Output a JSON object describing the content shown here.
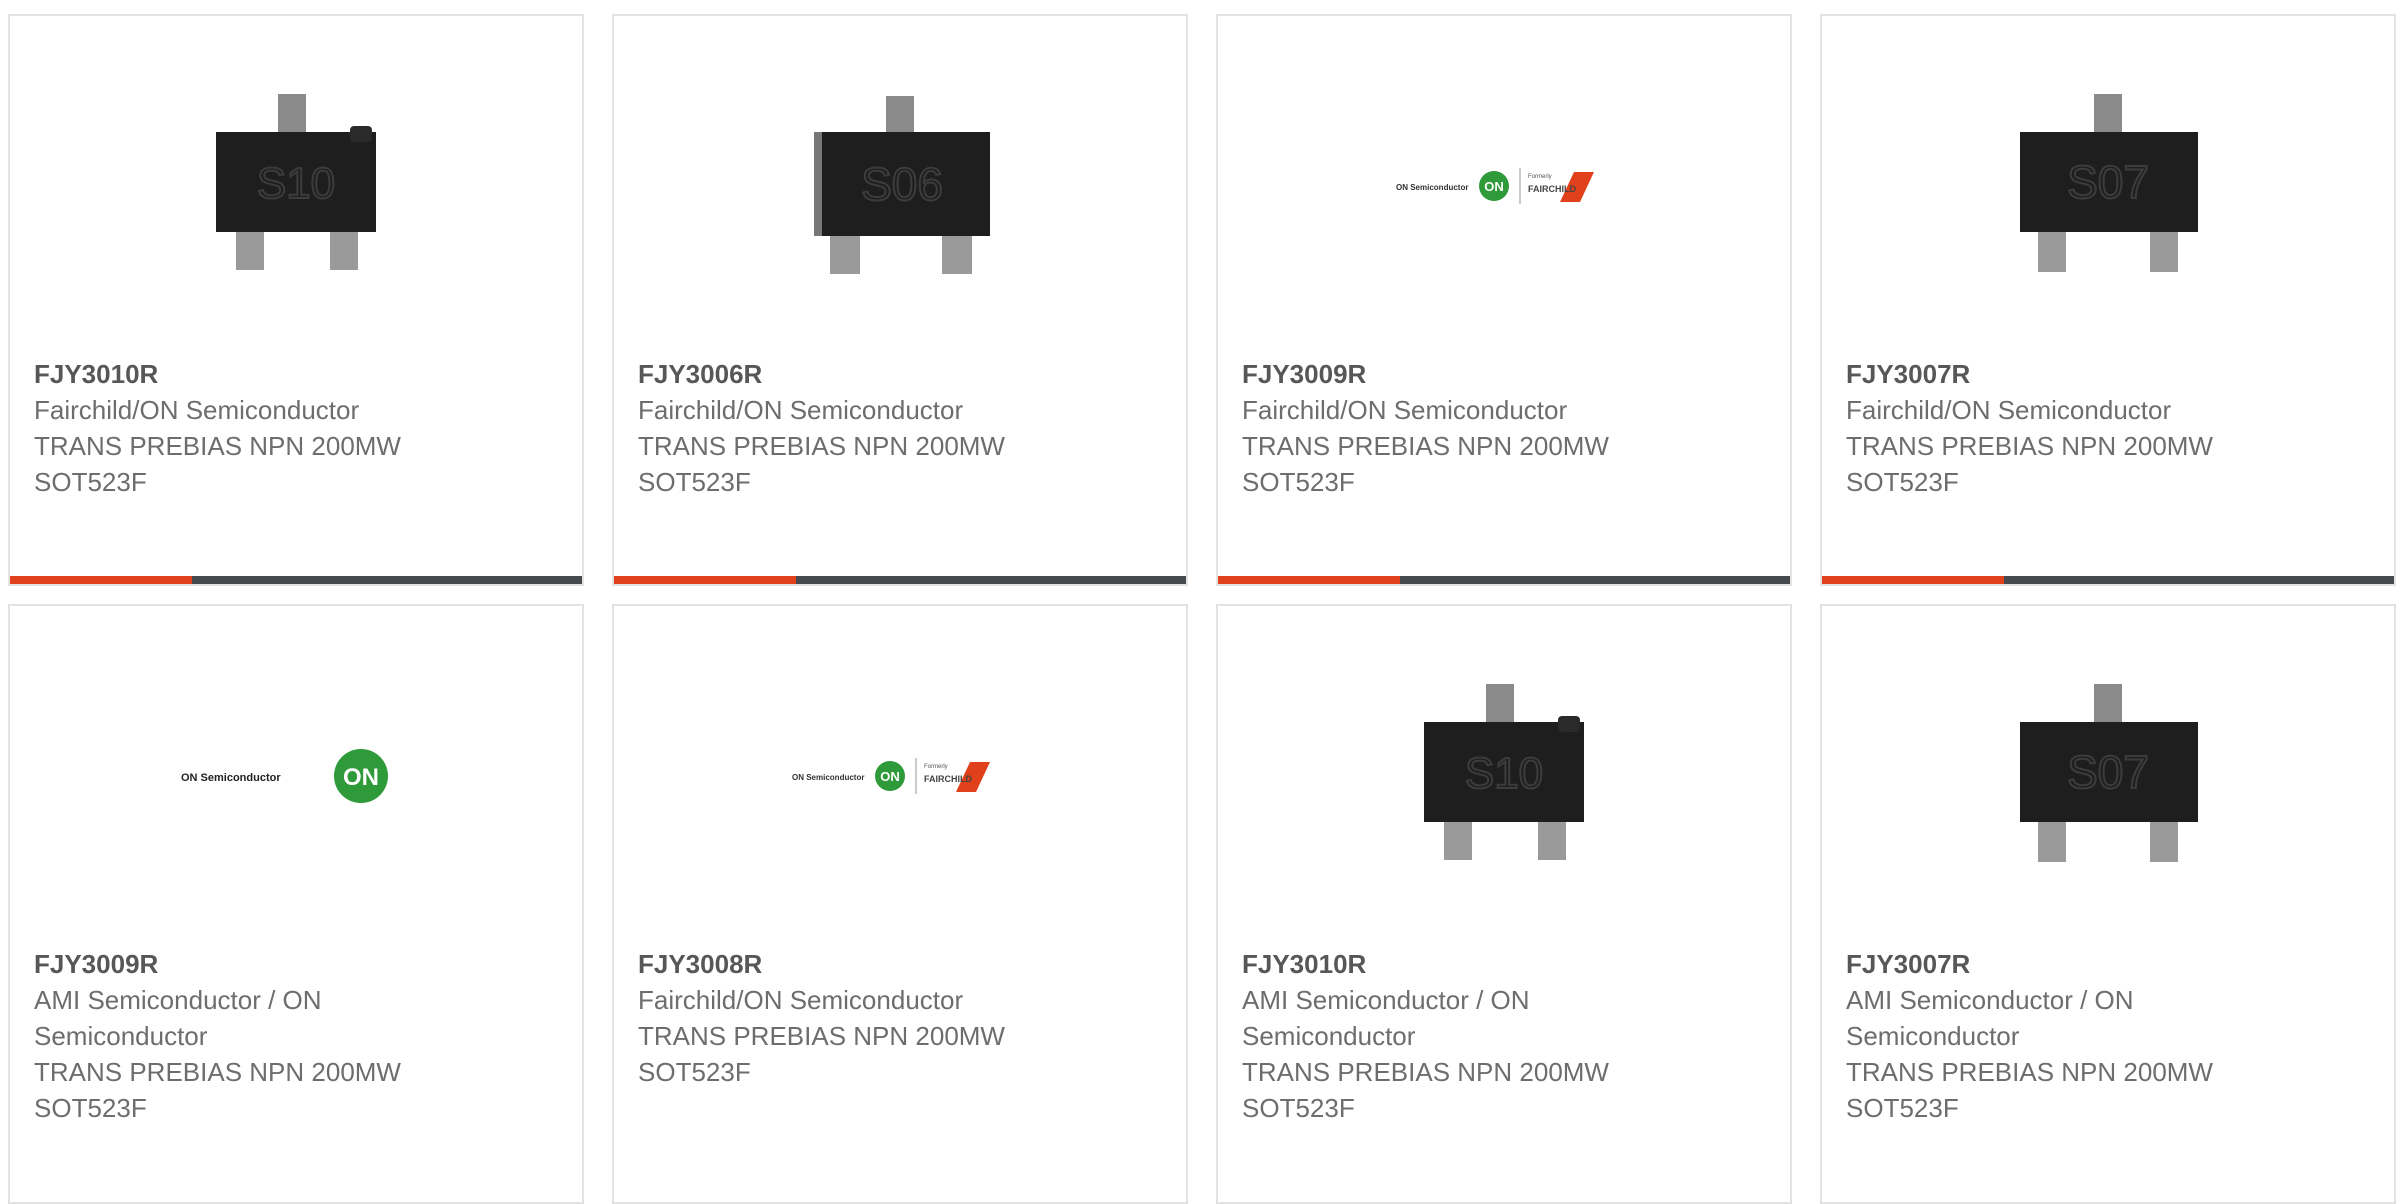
{
  "products": [
    {
      "part": "FJY3010R",
      "manufacturer": "Fairchild/ON Semiconductor",
      "description": "TRANS PREBIAS NPN 200MW",
      "package": "SOT523F",
      "image": "transistor-s10-icon",
      "marking": "S10"
    },
    {
      "part": "FJY3006R",
      "manufacturer": "Fairchild/ON Semiconductor",
      "description": "TRANS PREBIAS NPN 200MW",
      "package": "SOT523F",
      "image": "transistor-s06-icon",
      "marking": "S06"
    },
    {
      "part": "FJY3009R",
      "manufacturer": "Fairchild/ON Semiconductor",
      "description": "TRANS PREBIAS NPN 200MW",
      "package": "SOT523F",
      "image": "on-fairchild-logo",
      "logo_text": "ON Semiconductor",
      "logo_badge": "ON",
      "logo_small": "Formerly",
      "logo_brand": "FAIRCHILD"
    },
    {
      "part": "FJY3007R",
      "manufacturer": "Fairchild/ON Semiconductor",
      "description": "TRANS PREBIAS NPN 200MW",
      "package": "SOT523F",
      "image": "transistor-s07-icon",
      "marking": "S07"
    },
    {
      "part": "FJY3009R",
      "manufacturer": "AMI Semiconductor / ON Semiconductor",
      "description": "TRANS PREBIAS NPN 200MW",
      "package": "SOT523F",
      "image": "on-semiconductor-logo",
      "logo_text": "ON Semiconductor",
      "logo_badge": "ON"
    },
    {
      "part": "FJY3008R",
      "manufacturer": "Fairchild/ON Semiconductor",
      "description": "TRANS PREBIAS NPN 200MW",
      "package": "SOT523F",
      "image": "on-fairchild-logo",
      "logo_text": "ON Semiconductor",
      "logo_badge": "ON",
      "logo_small": "Formerly",
      "logo_brand": "FAIRCHILD"
    },
    {
      "part": "FJY3010R",
      "manufacturer": "AMI Semiconductor / ON Semiconductor",
      "description": "TRANS PREBIAS NPN 200MW",
      "package": "SOT523F",
      "image": "transistor-s10-icon",
      "marking": "S10"
    },
    {
      "part": "FJY3007R",
      "manufacturer": "AMI Semiconductor / ON Semiconductor",
      "description": "TRANS PREBIAS NPN 200MW",
      "package": "SOT523F",
      "image": "transistor-s07-icon",
      "marking": "S07"
    }
  ],
  "colors": {
    "accent": "#e0401a",
    "bar": "#444a4e",
    "border": "#e3e3e3",
    "on_green": "#2e9a3a",
    "fairchild_red": "#e0401a"
  }
}
